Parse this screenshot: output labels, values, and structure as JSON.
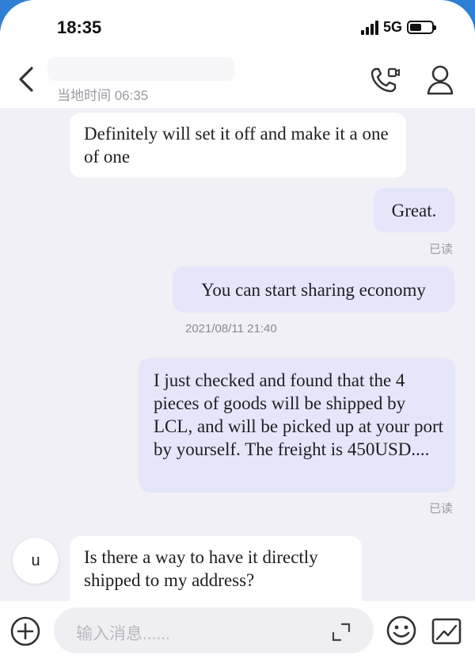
{
  "status_bar": {
    "time": "18:35",
    "network": "5G"
  },
  "header": {
    "local_time_label": "当地时间 06:35"
  },
  "messages": [
    {
      "direction": "in",
      "text": "Definitely will set it off and make it a one of one"
    },
    {
      "direction": "out",
      "text": "Great.",
      "status": "已读"
    },
    {
      "direction": "out",
      "text": "You can start sharing economy",
      "timestamp": "2021/08/11 21:40"
    },
    {
      "direction": "out",
      "text": "I just checked and found that the 4 pieces of goods will be shipped by LCL, and will be picked up at your port by yourself. The freight is 450USD....",
      "status": "已读"
    },
    {
      "direction": "in",
      "text": "Is there a way to have it directly shipped to my address?"
    }
  ],
  "contact": {
    "avatar_letter": "u"
  },
  "composer": {
    "placeholder": "输入消息......"
  },
  "colors": {
    "accent": "#2f7fd6",
    "outgoing_bubble": "#e6e6fa",
    "incoming_bubble": "#ffffff",
    "chat_background": "#f0f0f6"
  },
  "icons": [
    "back-chevron-icon",
    "video-call-icon",
    "profile-icon",
    "plus-icon",
    "expand-icon",
    "emoji-icon",
    "image-icon"
  ]
}
